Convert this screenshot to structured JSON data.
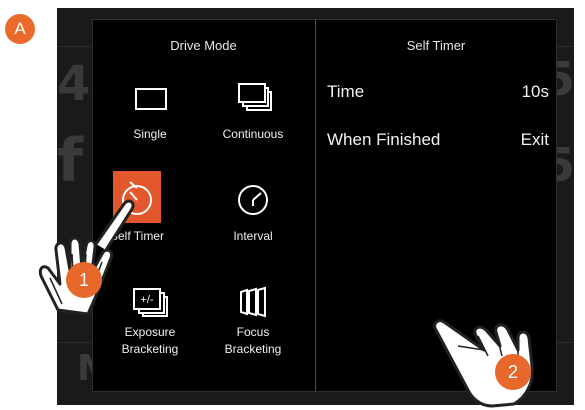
{
  "badge": {
    "label": "A"
  },
  "drive_mode": {
    "title": "Drive Mode",
    "modes": [
      {
        "label": "Single",
        "icon": "single-frame-icon",
        "selected": false
      },
      {
        "label": "Continuous",
        "icon": "continuous-frames-icon",
        "selected": false
      },
      {
        "label": "Self Timer",
        "icon": "self-timer-icon",
        "selected": true
      },
      {
        "label": "Interval",
        "icon": "interval-clock-icon",
        "selected": false
      },
      {
        "label": "Exposure\nBracketing",
        "icon": "exposure-bracketing-icon",
        "selected": false
      },
      {
        "label": "Focus\nBracketing",
        "icon": "focus-bracketing-icon",
        "selected": false
      }
    ]
  },
  "self_timer": {
    "title": "Self Timer",
    "rows": [
      {
        "name": "Time",
        "value": "10s"
      },
      {
        "name": "When Finished",
        "value": "Exit"
      }
    ]
  },
  "steps": {
    "one": "1",
    "two": "2"
  },
  "icon_text": {
    "exposure": "+/-"
  },
  "colors": {
    "accent": "#e2572b",
    "step_badge": "#e8672b",
    "overlay_bg": "#000000",
    "screen_bg": "#1a1a1a"
  }
}
